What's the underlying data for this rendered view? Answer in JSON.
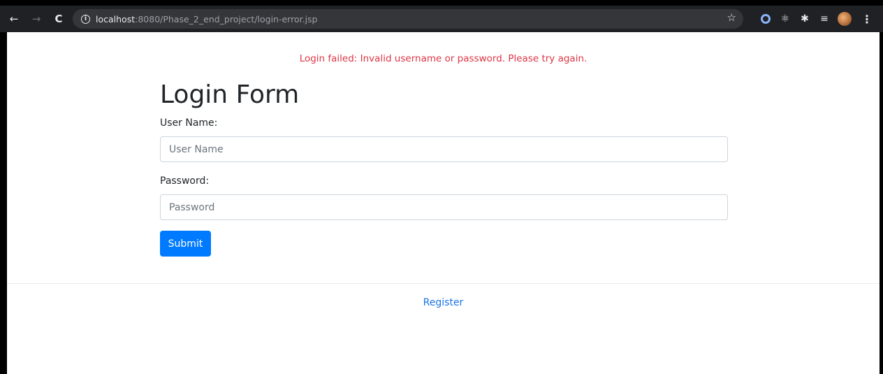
{
  "browser": {
    "url_host": "localhost",
    "url_rest": ":8080/Phase_2_end_project/login-error.jsp",
    "back_glyph": "←",
    "forward_glyph": "→",
    "reload_glyph": "C",
    "info_glyph": "i",
    "star_glyph": "☆",
    "extensions": [
      "circle-extension-icon",
      "react-icon",
      "puzzle-icon",
      "media-queue-icon"
    ],
    "ext_react_glyph": "⚛",
    "ext_puzzle_glyph": "✱",
    "ext_queue_glyph": "≡",
    "menu_glyph": "⋮"
  },
  "page": {
    "error_message": "Login failed: Invalid username or password. Please try again.",
    "title": "Login Form",
    "username_label": "User Name:",
    "username_placeholder": "User Name",
    "password_label": "Password:",
    "password_placeholder": "Password",
    "submit_label": "Submit",
    "register_link": "Register"
  },
  "colors": {
    "error": "#dc3545",
    "primary": "#007bff",
    "link": "#1a73e8",
    "toolbar": "#202124"
  }
}
